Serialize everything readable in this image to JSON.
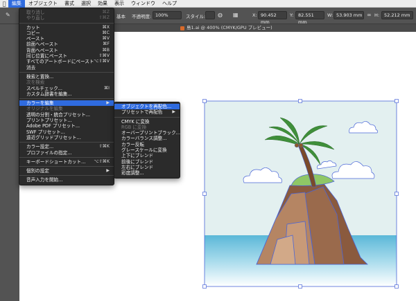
{
  "menubar": {
    "items": [
      "編集",
      "オブジェクト",
      "書式",
      "選択",
      "効果",
      "表示",
      "ウィンドウ",
      "ヘルプ"
    ],
    "active_index": 0
  },
  "control_bar": {
    "base_label": "基本",
    "opacity_label": "不透明度:",
    "opacity_value": "100%",
    "style_label": "スタイル:",
    "x_label": "X:",
    "x_value": "90.452 mm",
    "y_label": "Y:",
    "y_value": "82.551 mm",
    "w_label": "W:",
    "w_value": "53.903 mm",
    "h_label": "H:",
    "h_value": "52.212 mm"
  },
  "document_tab": {
    "title": "島1.ai @ 400% (CMYK/GPU プレビュー)"
  },
  "edit_menu": {
    "items": [
      {
        "label": "取り消し",
        "shortcut": "⌘Z",
        "disabled": true
      },
      {
        "label": "やり直し",
        "shortcut": "⇧⌘Z",
        "disabled": true
      },
      {
        "sep": true
      },
      {
        "label": "カット",
        "shortcut": "⌘X"
      },
      {
        "label": "コピー",
        "shortcut": "⌘C"
      },
      {
        "label": "ペースト",
        "shortcut": "⌘V"
      },
      {
        "label": "前面へペースト",
        "shortcut": "⌘F"
      },
      {
        "label": "背面へペースト",
        "shortcut": "⌘B"
      },
      {
        "label": "同じ位置にペースト",
        "shortcut": "⇧⌘V"
      },
      {
        "label": "すべてのアートボードにペースト",
        "shortcut": "⌥⇧⌘V"
      },
      {
        "label": "消去",
        "shortcut": ""
      },
      {
        "sep": true
      },
      {
        "label": "検索と置換...",
        "shortcut": ""
      },
      {
        "label": "次を検索",
        "shortcut": "",
        "disabled": true
      },
      {
        "label": "スペルチェック...",
        "shortcut": "⌘I"
      },
      {
        "label": "カスタム辞書を編集...",
        "shortcut": ""
      },
      {
        "sep": true
      },
      {
        "label": "カラーを編集",
        "shortcut": "",
        "submenu": true,
        "highlight": true
      },
      {
        "label": "オリジナルを編集",
        "shortcut": "",
        "disabled": true
      },
      {
        "label": "透明の分割・統合プリセット...",
        "shortcut": ""
      },
      {
        "label": "プリントプリセット...",
        "shortcut": ""
      },
      {
        "label": "Adobe PDF プリセット...",
        "shortcut": ""
      },
      {
        "label": "SWF プリセット...",
        "shortcut": ""
      },
      {
        "label": "遠近グリッドプリセット...",
        "shortcut": ""
      },
      {
        "sep": true
      },
      {
        "label": "カラー設定...",
        "shortcut": "⇧⌘K"
      },
      {
        "label": "プロファイルの指定...",
        "shortcut": ""
      },
      {
        "sep": true
      },
      {
        "label": "キーボードショートカット...",
        "shortcut": "⌥⇧⌘K"
      },
      {
        "sep": true
      },
      {
        "label": "個別の設定",
        "shortcut": "",
        "submenu": true
      },
      {
        "sep": true
      },
      {
        "label": "音声入力を開始...",
        "shortcut": ""
      }
    ]
  },
  "color_submenu": {
    "items": [
      {
        "label": "オブジェクトを再配色...",
        "highlight": true
      },
      {
        "label": "プリセットで再配色",
        "submenu": true
      },
      {
        "sep": true
      },
      {
        "label": "CMYK に変換"
      },
      {
        "label": "RGB に変換",
        "disabled": true
      },
      {
        "label": "オーバープリントブラック..."
      },
      {
        "label": "カラーバランス調整..."
      },
      {
        "label": "カラー反転"
      },
      {
        "label": "グレースケールに変換"
      },
      {
        "label": "上下にブレンド"
      },
      {
        "label": "前後にブレンド"
      },
      {
        "label": "左右にブレンド"
      },
      {
        "label": "彩度調整..."
      }
    ]
  },
  "colors": {
    "menu_bg": "#2b2b2b",
    "highlight": "#2f6bdf",
    "sky": "#e3f0f0",
    "sea": "#5bb8d8",
    "rock": "#a9785a",
    "leaf": "#3f8f3a",
    "selection": "#4a66d8"
  }
}
